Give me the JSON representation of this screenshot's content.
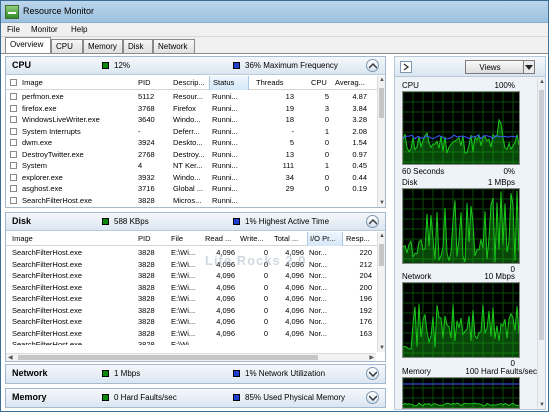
{
  "window": {
    "title": "Resource Monitor"
  },
  "menu": [
    "File",
    "Monitor",
    "Help"
  ],
  "tabs": [
    "Overview",
    "CPU",
    "Memory",
    "Disk",
    "Network"
  ],
  "watermark": "Life Rocks 2.0",
  "cpu": {
    "title": "CPU",
    "stat1": "12%",
    "stat2": "36% Maximum Frequency",
    "stat1_color": "#0a8a0a",
    "stat2_color": "#1f3fd0",
    "columns": [
      "Image",
      "PID",
      "Descrip...",
      "Status",
      "Threads",
      "CPU",
      "Averag..."
    ],
    "rows": [
      [
        "perfmon.exe",
        "5112",
        "Resour...",
        "Runni...",
        "13",
        "5",
        "4.87"
      ],
      [
        "firefox.exe",
        "3768",
        "Firefox",
        "Runni...",
        "19",
        "3",
        "3.84"
      ],
      [
        "WindowsLiveWriter.exe",
        "3640",
        "Windo...",
        "Runni...",
        "18",
        "0",
        "3.28"
      ],
      [
        "System Interrupts",
        "-",
        "Deferr...",
        "Runni...",
        "-",
        "1",
        "2.08"
      ],
      [
        "dwm.exe",
        "3924",
        "Deskto...",
        "Runni...",
        "5",
        "0",
        "1.54"
      ],
      [
        "DestroyTwitter.exe",
        "2768",
        "Destroy...",
        "Runni...",
        "13",
        "0",
        "0.97"
      ],
      [
        "System",
        "4",
        "NT Ker...",
        "Runni...",
        "111",
        "1",
        "0.45"
      ],
      [
        "explorer.exe",
        "3932",
        "Windo...",
        "Runni...",
        "34",
        "0",
        "0.44"
      ],
      [
        "asghost.exe",
        "3716",
        "Global ...",
        "Runni...",
        "29",
        "0",
        "0.19"
      ],
      [
        "SearchFilterHost.exe",
        "3828",
        "Micros...",
        "Runni...",
        "",
        "",
        ""
      ]
    ]
  },
  "disk": {
    "title": "Disk",
    "stat1": "588 KBps",
    "stat2": "1% Highest Active Time",
    "stat1_color": "#0a8a0a",
    "stat2_color": "#1f3fd0",
    "columns": [
      "Image",
      "PID",
      "File",
      "Read ...",
      "Write...",
      "Total ...",
      "I/O Pr...",
      "Resp..."
    ],
    "rows": [
      [
        "SearchFilterHost.exe",
        "3828",
        "E:\\Wi...",
        "4,096",
        "0",
        "4,096",
        "Nor...",
        "220"
      ],
      [
        "SearchFilterHost.exe",
        "3828",
        "E:\\Wi...",
        "4,096",
        "0",
        "4,096",
        "Nor...",
        "212"
      ],
      [
        "SearchFilterHost.exe",
        "3828",
        "E:\\Wi...",
        "4,096",
        "0",
        "4,096",
        "Nor...",
        "204"
      ],
      [
        "SearchFilterHost.exe",
        "3828",
        "E:\\Wi...",
        "4,096",
        "0",
        "4,096",
        "Nor...",
        "200"
      ],
      [
        "SearchFilterHost.exe",
        "3828",
        "E:\\Wi...",
        "4,096",
        "0",
        "4,096",
        "Nor...",
        "196"
      ],
      [
        "SearchFilterHost.exe",
        "3828",
        "E:\\Wi...",
        "4,096",
        "0",
        "4,096",
        "Nor...",
        "192"
      ],
      [
        "SearchFilterHost.exe",
        "3828",
        "E:\\Wi...",
        "4,096",
        "0",
        "4,096",
        "Nor...",
        "176"
      ],
      [
        "SearchFilterHost.exe",
        "3828",
        "E:\\Wi...",
        "4,096",
        "0",
        "4,096",
        "Nor...",
        "163"
      ],
      [
        "SearchFilterHost.exe",
        "3828",
        "E:\\Wi...",
        "",
        "",
        "",
        "",
        ""
      ]
    ]
  },
  "network": {
    "title": "Network",
    "stat1": "1 Mbps",
    "stat2": "1% Network Utilization",
    "stat1_color": "#0a8a0a",
    "stat2_color": "#1f3fd0"
  },
  "memory": {
    "title": "Memory",
    "stat1": "0 Hard Faults/sec",
    "stat2": "85% Used Physical Memory",
    "stat1_color": "#0a8a0a",
    "stat2_color": "#1f3fd0"
  },
  "right": {
    "views_label": "Views",
    "graphs": [
      {
        "name": "CPU",
        "top_right": "100%",
        "bottom_left": "60 Seconds",
        "bottom_right": "0%"
      },
      {
        "name": "Disk",
        "top_right": "1 MBps",
        "bottom_left": "",
        "bottom_right": "0"
      },
      {
        "name": "Network",
        "top_right": "10 Mbps",
        "bottom_left": "",
        "bottom_right": "0"
      },
      {
        "name": "Memory",
        "top_right": "100 Hard Faults/sec",
        "bottom_left": "",
        "bottom_right": ""
      }
    ],
    "graph_color": "#19c819"
  }
}
